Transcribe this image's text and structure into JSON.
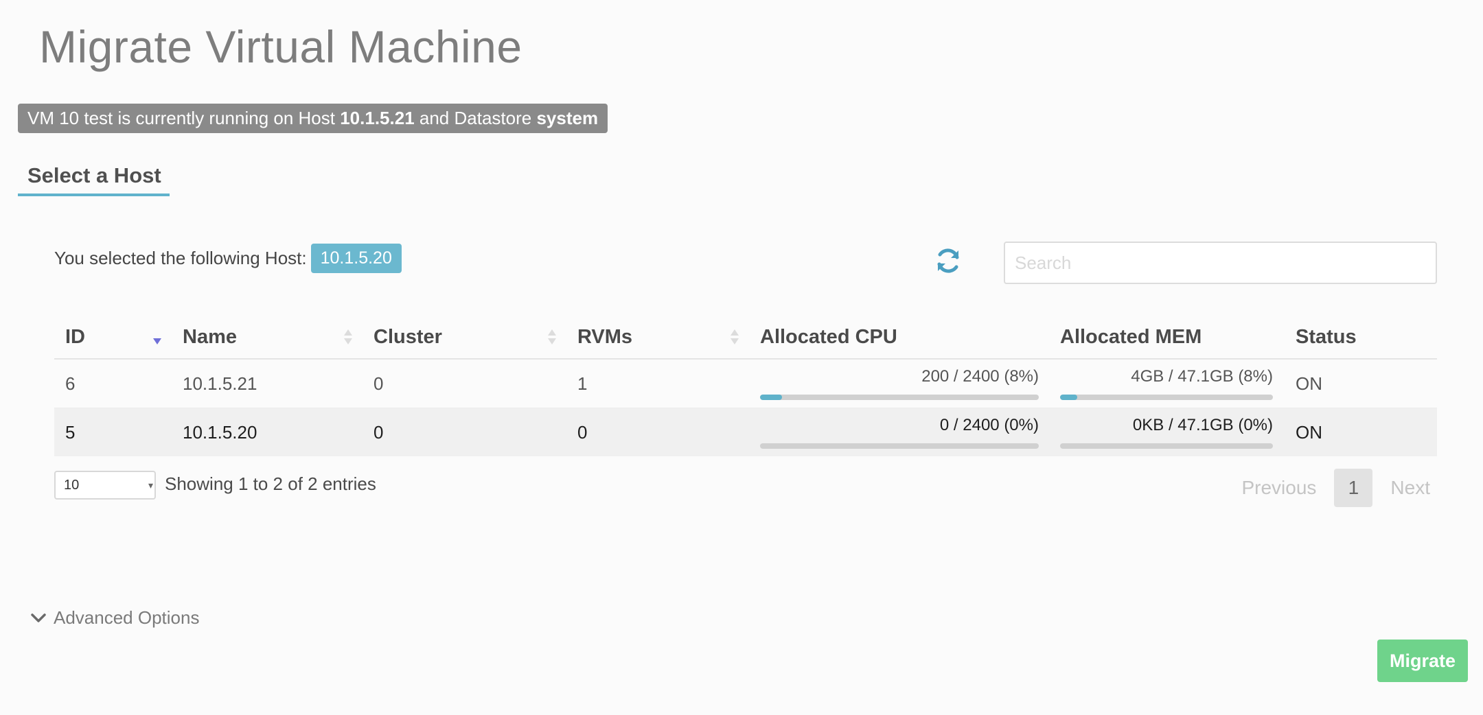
{
  "page": {
    "title": "Migrate Virtual Machine"
  },
  "banner": {
    "prefix": "VM 10 test is currently running on Host",
    "host": "10.1.5.21",
    "middle": "and Datastore",
    "datastore": "system"
  },
  "tab": {
    "label": "Select a Host"
  },
  "selection": {
    "label": "You selected the following Host:",
    "value": "10.1.5.20"
  },
  "search": {
    "placeholder": "Search"
  },
  "table": {
    "columns": [
      "ID",
      "Name",
      "Cluster",
      "RVMs",
      "Allocated CPU",
      "Allocated MEM",
      "Status"
    ],
    "rows": [
      {
        "id": "6",
        "name": "10.1.5.21",
        "cluster": "0",
        "rvms": "1",
        "cpu": "200 / 2400 (8%)",
        "cpu_pct": 8,
        "mem": "4GB / 47.1GB (8%)",
        "mem_pct": 8,
        "status": "ON"
      },
      {
        "id": "5",
        "name": "10.1.5.20",
        "cluster": "0",
        "rvms": "0",
        "cpu": "0 / 2400 (0%)",
        "cpu_pct": 0,
        "mem": "0KB / 47.1GB (0%)",
        "mem_pct": 0,
        "status": "ON"
      }
    ]
  },
  "footer": {
    "page_length": "10",
    "info": "Showing 1 to 2 of 2 entries",
    "previous": "Previous",
    "page": "1",
    "next": "Next"
  },
  "advanced": {
    "label": "Advanced Options"
  },
  "actions": {
    "migrate": "Migrate"
  },
  "colors": {
    "accent": "#60b3cc",
    "migrate": "#6fd38b",
    "banner": "#8a8a8a",
    "sort_active": "#6f6fd8"
  }
}
